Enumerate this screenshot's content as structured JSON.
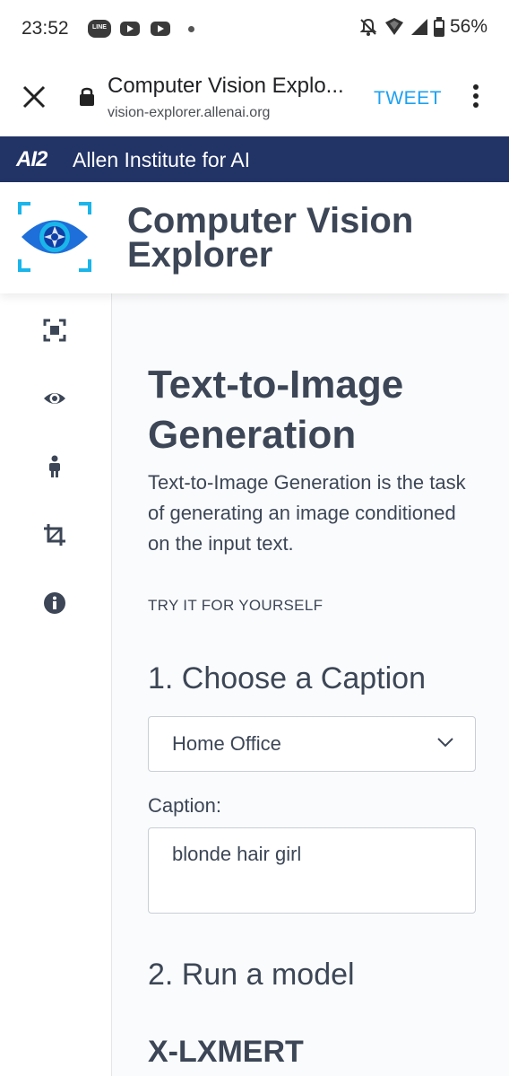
{
  "status_bar": {
    "time": "23:52",
    "line_label": "LINE",
    "battery": "56%"
  },
  "browser": {
    "page_title": "Computer Vision Explo...",
    "url": "vision-explorer.allenai.org",
    "tweet_label": "TWEET"
  },
  "banner": {
    "logo": "AI2",
    "org_name": "Allen Institute for AI",
    "color": "#223366"
  },
  "app": {
    "title": "Computer Vision Explorer",
    "logo_colors": {
      "eye": "#1e6fd9",
      "frame": "#1ab5ea"
    }
  },
  "sidebar": {
    "icons": [
      "detection-icon",
      "eye-icon",
      "person-icon",
      "crop-icon",
      "info-icon"
    ]
  },
  "main": {
    "heading": "Text-to-Image Generation",
    "description": "Text-to-Image Generation is the task of generating an image conditioned on the input text.",
    "try_label": "TRY IT FOR YOURSELF",
    "step1_label": "1. Choose a Caption",
    "caption_select_value": "Home Office",
    "caption_label": "Caption:",
    "caption_value": "blonde hair girl",
    "step2_label": "2. Run a model",
    "model_name": "X-LXMERT"
  },
  "colors": {
    "text": "#3c4656",
    "tweet": "#1da1f2",
    "sidebar_border": "#e3e6ea"
  }
}
